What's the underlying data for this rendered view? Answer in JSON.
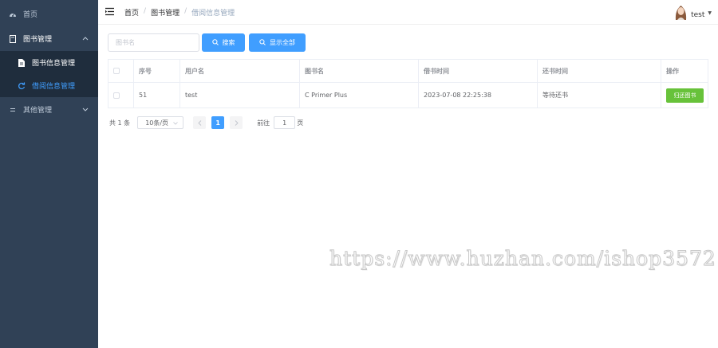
{
  "sidebar": {
    "home": "首页",
    "book_mgmt": "图书管理",
    "book_info": "图书信息管理",
    "borrow_info": "借阅信息管理",
    "other_mgmt": "其他管理"
  },
  "header": {
    "breadcrumb": [
      "首页",
      "图书管理",
      "借阅信息管理"
    ],
    "username": "test"
  },
  "search": {
    "placeholder": "图书名",
    "search_label": "搜索",
    "show_all_label": "显示全部"
  },
  "table": {
    "columns": [
      "序号",
      "用户名",
      "图书名",
      "借书时间",
      "还书时间",
      "操作"
    ],
    "rows": [
      {
        "id": "51",
        "username": "test",
        "book": "C Primer Plus",
        "borrow_time": "2023-07-08 22:25:38",
        "return_time": "等待还书",
        "action": "归还图书"
      }
    ]
  },
  "pagination": {
    "total": "共 1 条",
    "page_size": "10条/页",
    "current_page": "1",
    "goto_prefix": "前往",
    "goto_value": "1",
    "goto_suffix": "页"
  },
  "watermark": "https://www.huzhan.com/ishop3572",
  "colors": {
    "sidebar_bg": "#304156",
    "submenu_bg": "#1f2d3d",
    "primary": "#409eff",
    "success": "#67c23a",
    "danger": "#e4393c"
  }
}
